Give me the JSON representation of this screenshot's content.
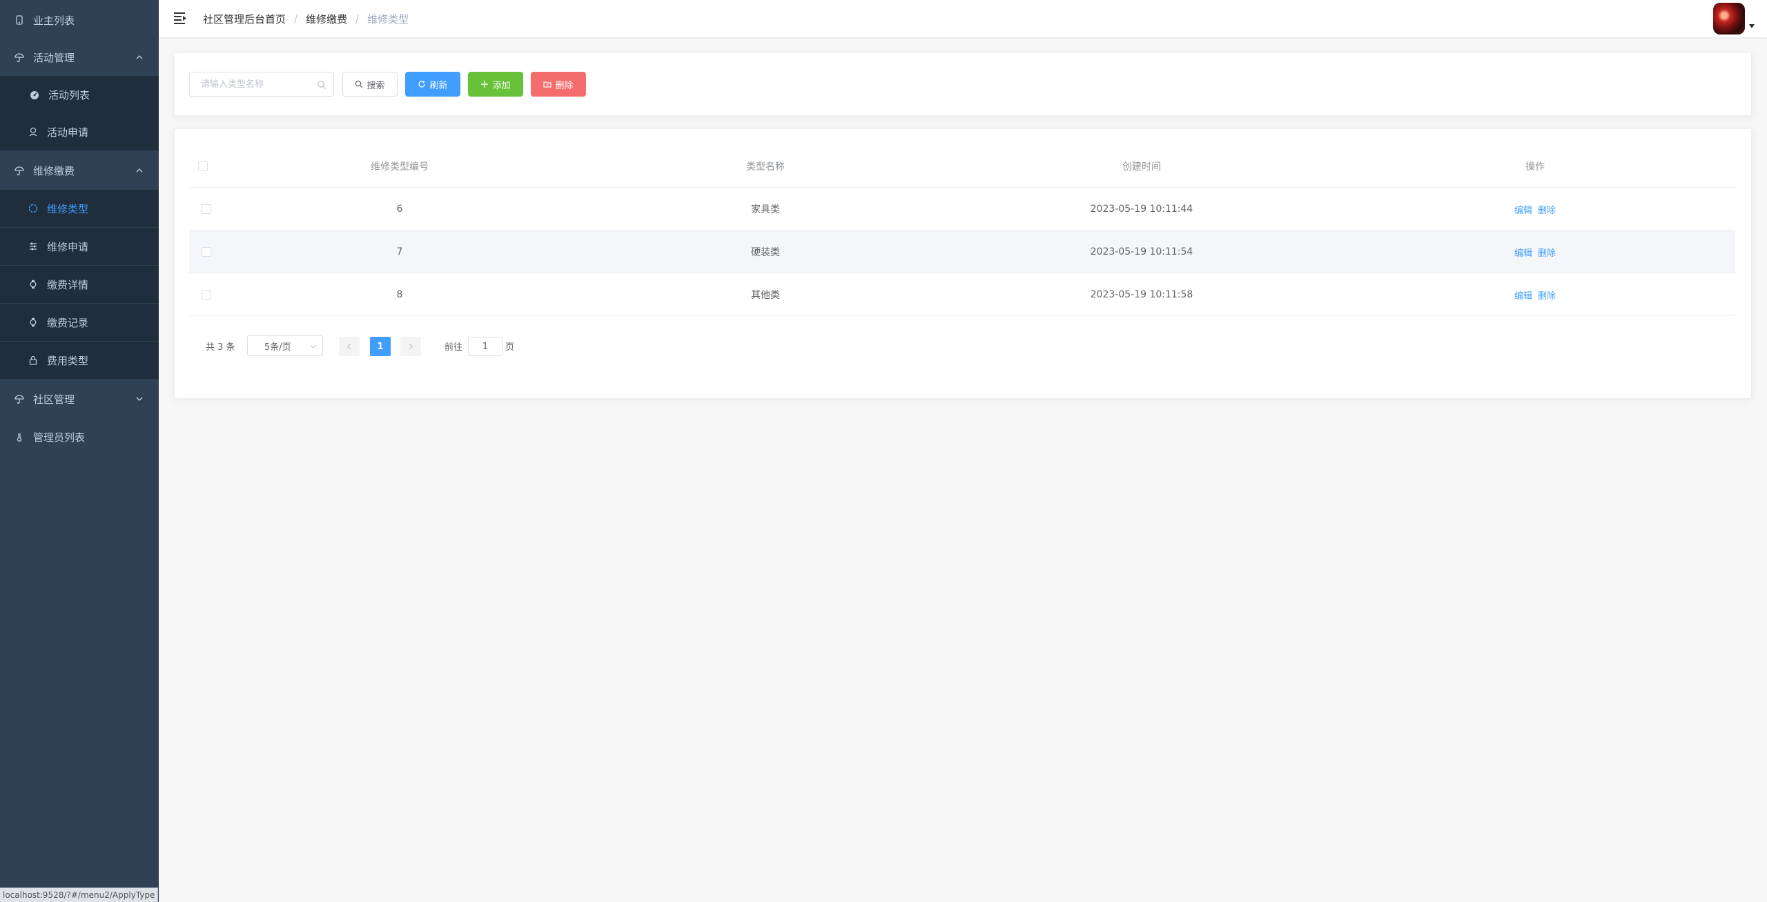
{
  "sidebar": {
    "items": [
      {
        "label": "业主列表",
        "icon": "phone-icon"
      },
      {
        "label": "活动管理",
        "icon": "umbrella-icon",
        "expanded": true
      },
      {
        "label": "活动列表",
        "icon": "dashboard-icon"
      },
      {
        "label": "活动申请",
        "icon": "user-search-icon"
      },
      {
        "label": "维修缴费",
        "icon": "umbrella-icon",
        "expanded": true
      },
      {
        "label": "维修类型",
        "icon": "circle-icon",
        "active": true
      },
      {
        "label": "维修申请",
        "icon": "sliders-icon"
      },
      {
        "label": "缴费详情",
        "icon": "watch-icon"
      },
      {
        "label": "缴费记录",
        "icon": "watch-icon"
      },
      {
        "label": "费用类型",
        "icon": "lock-icon"
      },
      {
        "label": "社区管理",
        "icon": "umbrella-icon",
        "expanded": false
      },
      {
        "label": "管理员列表",
        "icon": "thermometer-icon"
      }
    ]
  },
  "status_url": "localhost:9528/?#/menu2/ApplyType",
  "navbar": {
    "breadcrumb": [
      "社区管理后台首页",
      "维修缴费",
      "维修类型"
    ],
    "separator": "/"
  },
  "toolbar": {
    "search_placeholder": "请输入类型名称",
    "search_value": "",
    "search_label": "搜索",
    "refresh_label": "刷新",
    "add_label": "添加",
    "delete_label": "删除"
  },
  "table": {
    "headers": [
      "维修类型编号",
      "类型名称",
      "创建时间",
      "操作"
    ],
    "rows": [
      {
        "id": "6",
        "name": "家具类",
        "created": "2023-05-19 10:11:44"
      },
      {
        "id": "7",
        "name": "硬装类",
        "created": "2023-05-19 10:11:54"
      },
      {
        "id": "8",
        "name": "其他类",
        "created": "2023-05-19 10:11:58"
      }
    ],
    "edit_label": "编辑",
    "delete_label": "删除"
  },
  "pagination": {
    "total_text": "共 3 条",
    "page_size_text": "5条/页",
    "current_page": "1",
    "goto_label": "前往",
    "goto_value": "1",
    "page_suffix": "页"
  },
  "colors": {
    "sidebar_bg": "#304156",
    "submenu_bg": "#1f2d3d",
    "primary": "#409eff",
    "success": "#67c23a",
    "danger": "#f56c6c"
  }
}
